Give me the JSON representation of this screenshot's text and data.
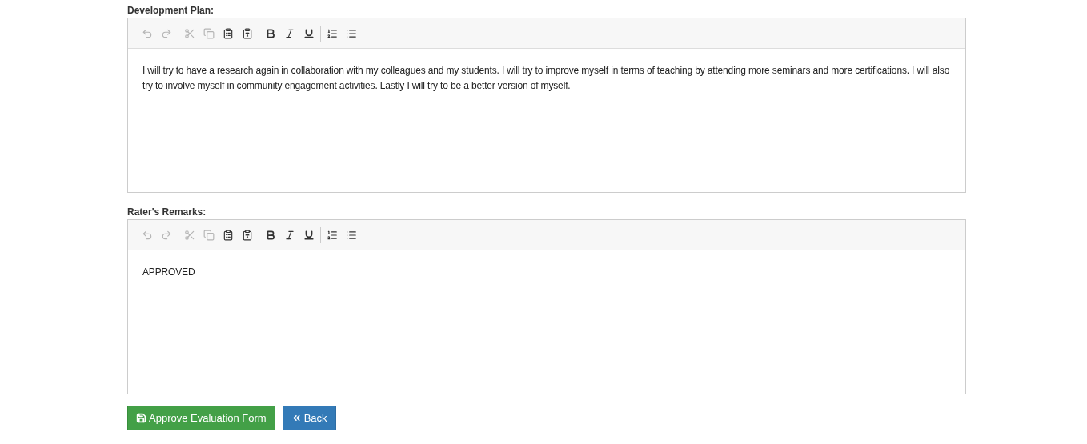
{
  "editors": [
    {
      "label": "Development Plan:",
      "toolbar": [
        [
          {
            "kind": "undo",
            "disabled": true
          },
          {
            "kind": "redo",
            "disabled": true
          }
        ],
        [
          {
            "kind": "cut",
            "disabled": true
          },
          {
            "kind": "copy",
            "disabled": true
          },
          {
            "kind": "paste",
            "disabled": false
          },
          {
            "kind": "paste-text",
            "disabled": false
          }
        ],
        [
          {
            "kind": "bold",
            "disabled": false
          },
          {
            "kind": "italic",
            "disabled": false
          },
          {
            "kind": "underline",
            "disabled": false
          }
        ],
        [
          {
            "kind": "ordered-list",
            "disabled": false
          },
          {
            "kind": "bullet-list",
            "disabled": false
          }
        ]
      ],
      "content": "I will try to have a research again in collaboration with my colleagues and my students. I will try to improve myself in terms of teaching by attending more seminars and more certifications. I will also try to involve myself in community engagement activities. Lastly I will try to be a better version of myself."
    },
    {
      "label": "Rater's Remarks:",
      "toolbar": [
        [
          {
            "kind": "undo",
            "disabled": true
          },
          {
            "kind": "redo",
            "disabled": true
          }
        ],
        [
          {
            "kind": "cut",
            "disabled": true
          },
          {
            "kind": "copy",
            "disabled": true
          },
          {
            "kind": "paste",
            "disabled": false
          },
          {
            "kind": "paste-text",
            "disabled": false
          }
        ],
        [
          {
            "kind": "bold",
            "disabled": false
          },
          {
            "kind": "italic",
            "disabled": false
          },
          {
            "kind": "underline",
            "disabled": false
          }
        ],
        [
          {
            "kind": "ordered-list",
            "disabled": false
          },
          {
            "kind": "bullet-list",
            "disabled": false
          }
        ]
      ],
      "content": "APPROVED"
    }
  ],
  "buttons": [
    {
      "kind": "save",
      "label": "Approve Evaluation Form"
    },
    {
      "kind": "back",
      "label": "Back"
    }
  ]
}
